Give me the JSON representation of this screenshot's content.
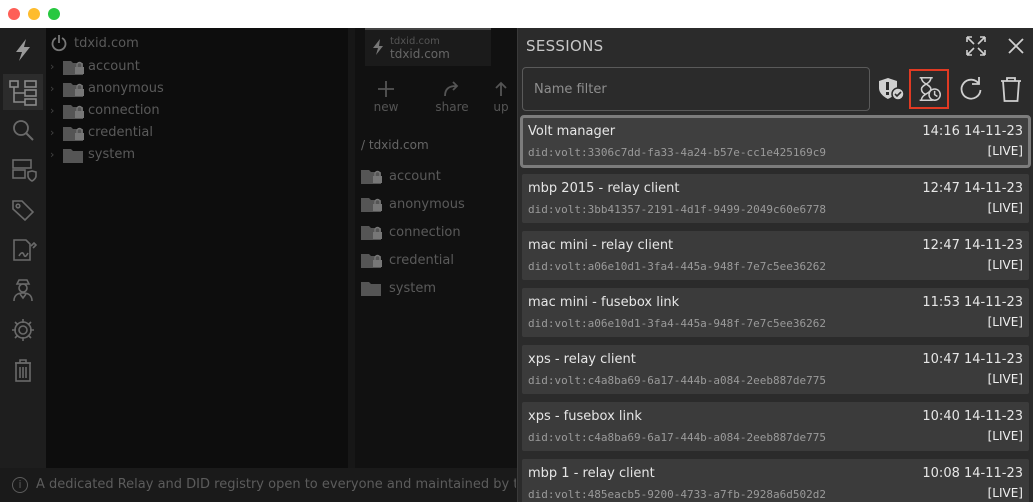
{
  "window": {
    "controls": [
      "close",
      "minimize",
      "maximize"
    ]
  },
  "rail": {
    "icons": [
      "bolt-icon",
      "tree-view-icon",
      "search-icon",
      "server-shield-icon",
      "tags-icon",
      "signature-icon",
      "agent-icon",
      "settings-icon",
      "trash-icon"
    ]
  },
  "tree": {
    "root": "tdxid.com",
    "items": [
      {
        "label": "account",
        "locked": true
      },
      {
        "label": "anonymous",
        "locked": true
      },
      {
        "label": "connection",
        "locked": true
      },
      {
        "label": "credential",
        "locked": true
      },
      {
        "label": "system",
        "locked": false
      }
    ]
  },
  "center": {
    "tab_top": "tdxid.com",
    "tab_main": "tdxid.com",
    "tools": {
      "new": "new",
      "share": "share",
      "upload": "up"
    },
    "path": "/ tdxid.com",
    "items": [
      {
        "label": "account",
        "locked": true
      },
      {
        "label": "anonymous",
        "locked": true
      },
      {
        "label": "connection",
        "locked": true
      },
      {
        "label": "credential",
        "locked": true
      },
      {
        "label": "system",
        "locked": false
      }
    ]
  },
  "status": {
    "message": "A dedicated Relay and DID registry open to everyone and maintained by the tdx Volt"
  },
  "panel": {
    "title": "SESSIONS",
    "filter_placeholder": "Name filter",
    "colors": {
      "highlight": "#e03a23",
      "row": "#3b3b3b"
    },
    "sessions": [
      {
        "name": "Volt manager",
        "time": "14:16 14-11-23",
        "did": "did:volt:3306c7dd-fa33-4a24-b57e-cc1e425169c9",
        "state": "[LIVE]"
      },
      {
        "name": "mbp 2015 - relay client",
        "time": "12:47 14-11-23",
        "did": "did:volt:3bb41357-2191-4d1f-9499-2049c60e6778",
        "state": "[LIVE]"
      },
      {
        "name": "mac mini - relay client",
        "time": "12:47 14-11-23",
        "did": "did:volt:a06e10d1-3fa4-445a-948f-7e7c5ee36262",
        "state": "[LIVE]"
      },
      {
        "name": "mac mini - fusebox link",
        "time": "11:53 14-11-23",
        "did": "did:volt:a06e10d1-3fa4-445a-948f-7e7c5ee36262",
        "state": "[LIVE]"
      },
      {
        "name": "xps - relay client",
        "time": "10:47 14-11-23",
        "did": "did:volt:c4a8ba69-6a17-444b-a084-2eeb887de775",
        "state": "[LIVE]"
      },
      {
        "name": "xps - fusebox link",
        "time": "10:40 14-11-23",
        "did": "did:volt:c4a8ba69-6a17-444b-a084-2eeb887de775",
        "state": "[LIVE]"
      },
      {
        "name": "mbp 1 - relay client",
        "time": "10:08 14-11-23",
        "did": "did:volt:485eacb5-9200-4733-a7fb-2928a6d502d2",
        "state": "[LIVE]"
      }
    ]
  }
}
